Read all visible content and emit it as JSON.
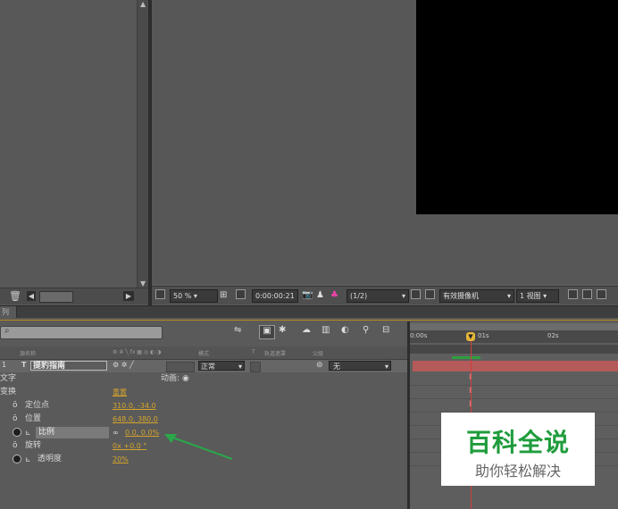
{
  "project_panel": {
    "scroll_up": "▲",
    "scroll_down": "▼",
    "trash": "🗑",
    "arrow_left": "◀",
    "arrow_right": "▶"
  },
  "viewer_bar": {
    "zoom": "50 %",
    "timecode": "0:00:00:21",
    "resolution": "(1/2)",
    "camera": "有效摄像机",
    "views": "1 视图"
  },
  "timeline_tab": "列",
  "search_icon": "⌕",
  "columns": {
    "source_name": "源名称",
    "mode": "模式",
    "t": "T",
    "trkmat": "轨道遮罩",
    "parent": "父级"
  },
  "layer": {
    "index": "1",
    "type_icon": "T",
    "name": "提豹指南",
    "mode": "正常",
    "parent": "无"
  },
  "properties": {
    "text_group": "文字",
    "animate_label": "动画:",
    "transform_group": "变换",
    "reset": "重置",
    "anchor_label": "定位点",
    "anchor_value": "310.0, -34.0",
    "position_label": "位置",
    "position_value": "648.0, 380.0",
    "scale_label": "比例",
    "scale_value": "0.0, 0.0%",
    "rotation_label": "旋转",
    "rotation_value": "0x +0.0 °",
    "opacity_label": "透明度",
    "opacity_value": "20%"
  },
  "ruler": {
    "t0": "0:00s",
    "t1": "01s",
    "t2": "02s"
  },
  "watermark": {
    "title": "百科全说",
    "subtitle": "助你轻松解决"
  },
  "colors": {
    "accent_orange": "#d6a52b",
    "layer_bar": "#b45a5a",
    "cti": "#d13d3d",
    "arrow_green": "#2aa84a"
  }
}
